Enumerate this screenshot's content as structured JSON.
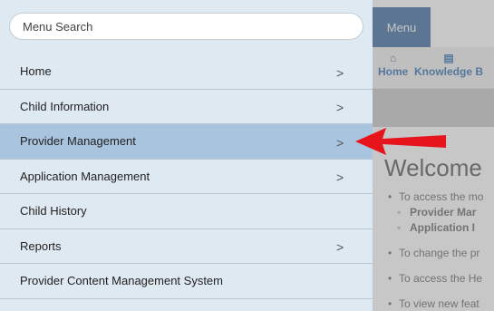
{
  "search": {
    "placeholder": "Menu Search"
  },
  "menu": {
    "items": [
      {
        "label": "Home",
        "has_submenu": true
      },
      {
        "label": "Child Information",
        "has_submenu": true
      },
      {
        "label": "Provider Management",
        "has_submenu": true,
        "active": true
      },
      {
        "label": "Application Management",
        "has_submenu": true
      },
      {
        "label": "Child History",
        "has_submenu": false
      },
      {
        "label": "Reports",
        "has_submenu": true
      },
      {
        "label": "Provider Content Management System",
        "has_submenu": false
      }
    ],
    "chevron": ">"
  },
  "background": {
    "menu_tab": "Menu",
    "toolbar": [
      {
        "label": "Home",
        "icon": "home-icon"
      },
      {
        "label": "Knowledge B",
        "icon": "document-icon"
      }
    ],
    "welcome": "Welcome",
    "bullets": [
      {
        "text": "To access the mo"
      },
      {
        "text": "Provider Mar",
        "sub": true
      },
      {
        "text": "Application I",
        "sub": true
      },
      {
        "text": "To change the pr"
      },
      {
        "text": "To access the He"
      },
      {
        "text": "To view new feat"
      }
    ]
  },
  "colors": {
    "panel_bg": "#dfe9f2",
    "active_item_bg": "#a9c4de",
    "menu_tab_bg": "#3b6aa0",
    "annotation_arrow": "#e8141c"
  }
}
